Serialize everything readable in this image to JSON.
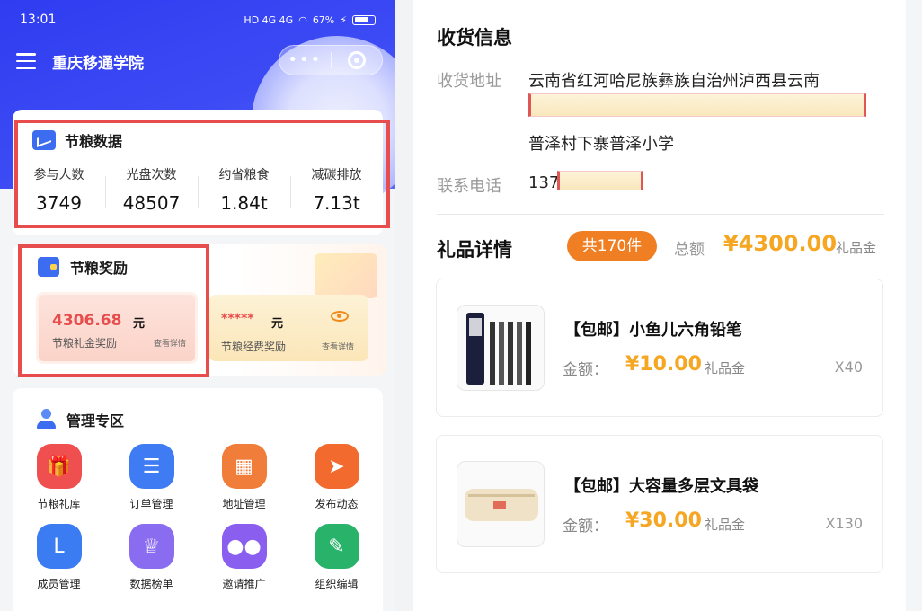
{
  "phone": {
    "time": "13:01",
    "signal": "HD 4G 4G",
    "battery": "67%",
    "title": "重庆移通学院",
    "capsule_more": "•••"
  },
  "grain_data": {
    "title": "节粮数据",
    "stats": [
      {
        "label": "参与人数",
        "value": "3749"
      },
      {
        "label": "光盘次数",
        "value": "48507"
      },
      {
        "label": "约省粮食",
        "value": "1.84t"
      },
      {
        "label": "减碳排放",
        "value": "7.13t"
      }
    ]
  },
  "reward": {
    "title": "节粮奖励",
    "gift": {
      "amount": "4306.68",
      "unit": "元",
      "label": "节粮礼金奖励",
      "link": "查看详情"
    },
    "fund": {
      "amount": "*****",
      "unit": "元",
      "label": "节粮经费奖励",
      "link": "查看详情"
    }
  },
  "admin": {
    "title": "管理专区",
    "items": [
      {
        "label": "节粮礼库",
        "icon": "gift-box-icon",
        "color": "#ef4f4f"
      },
      {
        "label": "订单管理",
        "icon": "order-list-icon",
        "color": "#3f7cf4"
      },
      {
        "label": "地址管理",
        "icon": "address-icon",
        "color": "#f07e3a"
      },
      {
        "label": "发布动态",
        "icon": "paper-plane-icon",
        "color": "#f26a2e"
      },
      {
        "label": "成员管理",
        "icon": "member-icon",
        "color": "#3b7cf2"
      },
      {
        "label": "数据榜单",
        "icon": "trophy-icon",
        "color": "#8a6cf0"
      },
      {
        "label": "邀请推广",
        "icon": "invite-icon",
        "color": "#8a5ff0"
      },
      {
        "label": "组织编辑",
        "icon": "org-edit-icon",
        "color": "#29b36a"
      }
    ]
  },
  "shipping": {
    "title": "收货信息",
    "address_label": "收货地址",
    "address_line1": "云南省红河哈尼族彝族自治州泸西县云南",
    "address_line3": "普泽村下寨普泽小学",
    "phone_label": "联系电话",
    "phone_prefix": "137"
  },
  "gifts": {
    "title": "礼品详情",
    "count": "共170件",
    "total_label": "总额",
    "total": "¥4300.00",
    "total_unit": "礼品金",
    "items": [
      {
        "name": "【包邮】小鱼儿六角铅笔",
        "amount_label": "金额：",
        "amount": "¥10.00",
        "unit": "礼品金",
        "qty": "X40"
      },
      {
        "name": "【包邮】大容量多层文具袋",
        "amount_label": "金额：",
        "amount": "¥30.00",
        "unit": "礼品金",
        "qty": "X130"
      }
    ]
  },
  "colors": {
    "brand_blue": "#3d4bf5",
    "highlight_red": "#e84d4d",
    "price_orange": "#f5a623",
    "badge_orange": "#f07e22"
  }
}
